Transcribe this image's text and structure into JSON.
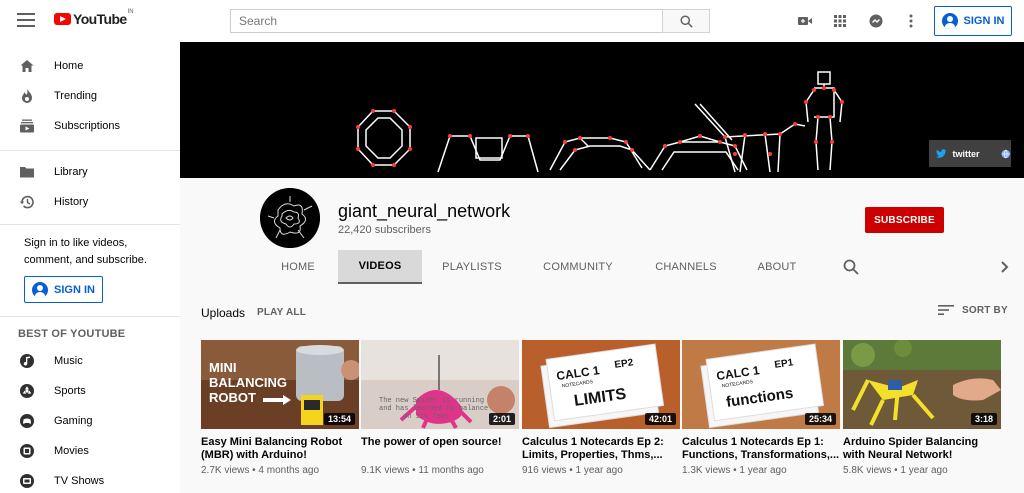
{
  "topbar": {
    "logo_text": "YouTube",
    "country_code": "IN",
    "search_placeholder": "Search",
    "sign_in_label": "SIGN IN"
  },
  "sidebar": {
    "primary": [
      {
        "label": "Home",
        "icon": "home-icon"
      },
      {
        "label": "Trending",
        "icon": "flame-icon"
      },
      {
        "label": "Subscriptions",
        "icon": "subscriptions-icon"
      }
    ],
    "secondary": [
      {
        "label": "Library",
        "icon": "folder-icon"
      },
      {
        "label": "History",
        "icon": "history-icon"
      }
    ],
    "sign_in_message": "Sign in to like videos, comment, and subscribe.",
    "sign_in_label": "SIGN IN",
    "best_of_heading": "BEST OF YOUTUBE",
    "best_of": [
      {
        "label": "Music",
        "icon": "music-icon"
      },
      {
        "label": "Sports",
        "icon": "sports-icon"
      },
      {
        "label": "Gaming",
        "icon": "gaming-icon"
      },
      {
        "label": "Movies",
        "icon": "movies-icon"
      },
      {
        "label": "TV Shows",
        "icon": "tv-icon"
      }
    ]
  },
  "banner": {
    "link_label": "twitter"
  },
  "channel": {
    "name": "giant_neural_network",
    "subscribers": "22,420 subscribers",
    "subscribe_label": "SUBSCRIBE",
    "tabs": [
      {
        "label": "HOME",
        "active": false
      },
      {
        "label": "VIDEOS",
        "active": true
      },
      {
        "label": "PLAYLISTS",
        "active": false
      },
      {
        "label": "COMMUNITY",
        "active": false
      },
      {
        "label": "CHANNELS",
        "active": false
      },
      {
        "label": "ABOUT",
        "active": false
      }
    ]
  },
  "uploads": {
    "title": "Uploads",
    "play_all_label": "PLAY ALL",
    "sort_label": "SORT BY",
    "videos": [
      {
        "title": "Easy Mini Balancing Robot (MBR) with Arduino!",
        "views": "2.7K views",
        "age": "4 months ago",
        "duration": "13:54",
        "thumb_text": [
          "MINI",
          "BALANCING",
          "ROBOT"
        ]
      },
      {
        "title": "The power of open source!",
        "views": "9.1K views",
        "age": "11 months ago",
        "duration": "2:01",
        "thumb_text": [
          "The new Spider is running",
          "and has learned to balance",
          "on its feet"
        ]
      },
      {
        "title": "Calculus 1 Notecards Ep 2: Limits, Properties, Thms,...",
        "views": "916 views",
        "age": "1 year ago",
        "duration": "42:01",
        "thumb_text": [
          "CALC 1",
          "EP2",
          "NOTECARDS",
          "LIMITS"
        ]
      },
      {
        "title": "Calculus 1 Notecards Ep 1: Functions, Transformations,...",
        "views": "1.3K views",
        "age": "1 year ago",
        "duration": "25:34",
        "thumb_text": [
          "CALC 1",
          "EP1",
          "NOTECARDS",
          "functions"
        ]
      },
      {
        "title": "Arduino Spider Balancing with Neural Network!",
        "views": "5.8K views",
        "age": "1 year ago",
        "duration": "3:18",
        "thumb_text": []
      }
    ]
  },
  "colors": {
    "accent_blue": "#065fd4",
    "subscribe_red": "#cc0000",
    "logo_red": "#ff0000"
  }
}
